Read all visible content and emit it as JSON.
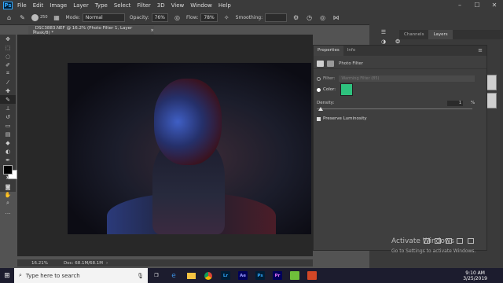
{
  "menu": {
    "logo": "Ps",
    "items": [
      "File",
      "Edit",
      "Image",
      "Layer",
      "Type",
      "Select",
      "Filter",
      "3D",
      "View",
      "Window",
      "Help"
    ]
  },
  "options": {
    "brush_size": "250",
    "mode_label": "Mode:",
    "mode_value": "Normal",
    "opacity_label": "Opacity:",
    "opacity_value": "76%",
    "flow_label": "Flow:",
    "flow_value": "78%",
    "smoothing_label": "Smoothing:"
  },
  "document": {
    "tab_title": "_DSC3883.NEF @ 16.2% (Photo Filter 1, Layer Mask/8) *",
    "zoom": "16.21%",
    "doc_size": "Doc: 68.1M/68.1M"
  },
  "layers_panel": {
    "tabs": [
      "Channels",
      "Layers"
    ],
    "active_tab": "Layers"
  },
  "properties": {
    "tabs": [
      "Properties",
      "Info"
    ],
    "active_tab": "Properties",
    "header": "Photo Filter",
    "filter_label": "Filter:",
    "filter_value": "Warming Filter (85)",
    "color_label": "Color:",
    "color_swatch": "#2ec27e",
    "density_label": "Density:",
    "density_value": "1",
    "density_unit": "%",
    "preserve_label": "Preserve Luminosity"
  },
  "watermark": {
    "title": "Activate Windows",
    "subtitle": "Go to Settings to activate Windows."
  },
  "taskbar": {
    "search_placeholder": "Type here to search",
    "apps": [
      "Lr",
      "Ae",
      "Ps",
      "Pr"
    ],
    "time": "9:10 AM",
    "date": "3/25/2019"
  }
}
